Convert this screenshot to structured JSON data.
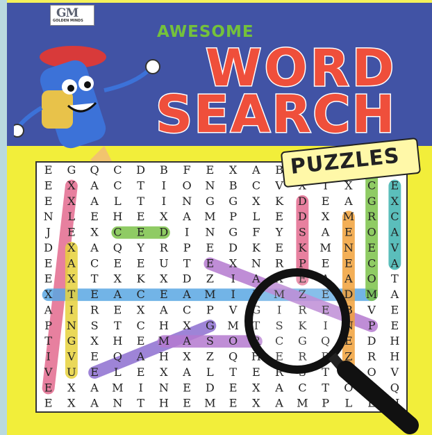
{
  "logo": {
    "mark": "GM",
    "sub": "GOLDEN MINDS"
  },
  "awesome": "AWESOME",
  "title_line1": "WORD",
  "title_line2": "SEARCH",
  "puzzles": "PUZZLES",
  "grid_rows": [
    "EGQCDBFEXABEPUZZLES",
    "EXACTIONBCVXIXCE",
    "EXALTINGGXKDEAGX",
    "NLEHEXAMPLEDXMRC",
    "JEXCEDINGFYSAEOA",
    "DXAQYRPEDKEKMNEV",
    "EACEEUTEXNRPEECA",
    "EXTXKXDZIAXEAAOT",
    "XTEACEAMILMZEDMA",
    "AIREXACPVGIREBVE",
    "PNSTCHXGMTSKINPE",
    "TGXHEMASORCGQEDH",
    "IVEQAHXZQHERRZRH",
    "VUELEXALTERSTMOV",
    "EXAMINEDEXACTOUQ",
    "EXANTHEMEXAMPLEH"
  ],
  "highlight_colors": [
    "#e36b8f",
    "#5aa7e3",
    "#7cc24a",
    "#b57ad0",
    "#f2a23a",
    "#3fb3b0",
    "#e7d23c",
    "#8e6fd1"
  ]
}
